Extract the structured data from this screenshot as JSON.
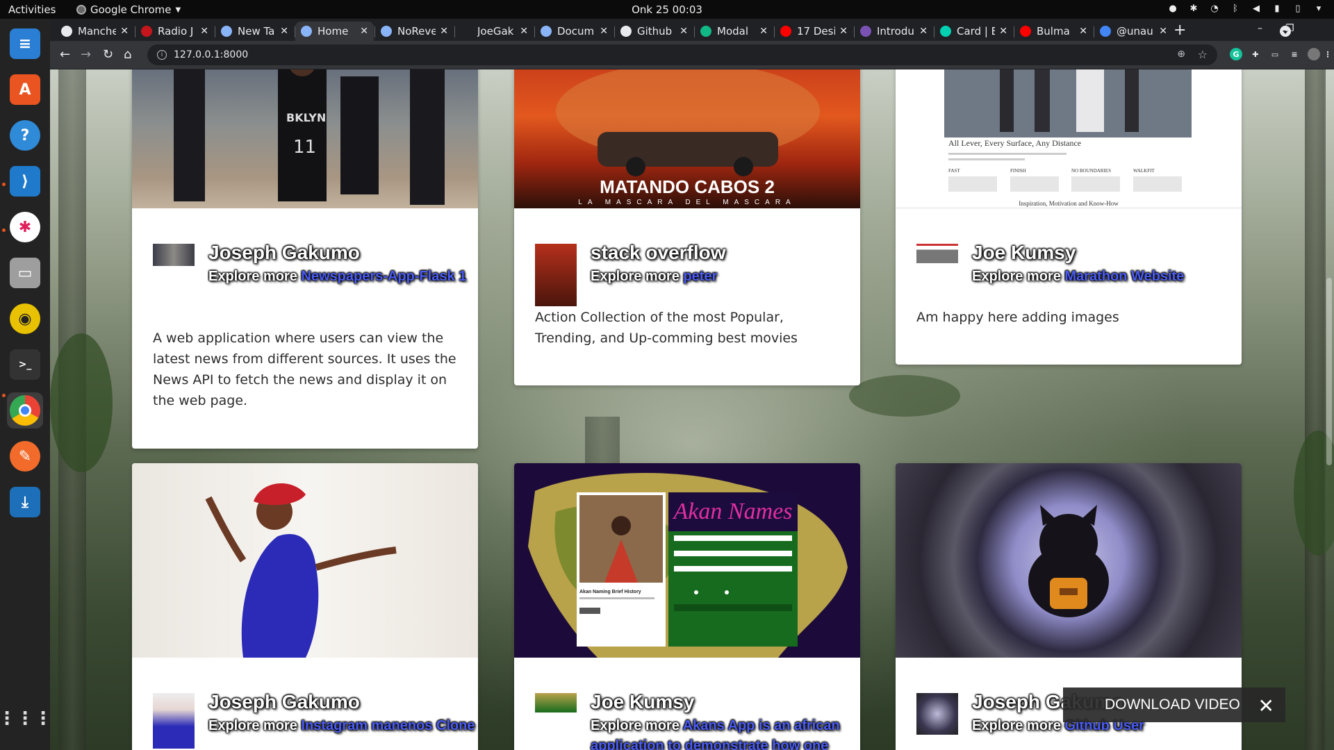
{
  "topbar": {
    "activities": "Activities",
    "app_name": "Google Chrome",
    "clock": "Onk 25  00:03"
  },
  "browser": {
    "tabs": [
      {
        "label": "Manche",
        "fav_color": "#e8eaed"
      },
      {
        "label": "Radio J",
        "fav_color": "#c4161c"
      },
      {
        "label": "New Ta",
        "fav_color": "#8ab4f8"
      },
      {
        "label": "Home",
        "fav_color": "#8ab4f8"
      },
      {
        "label": "NoReve",
        "fav_color": "#8ab4f8"
      },
      {
        "label": "JoeGak",
        "fav_color": "#202124"
      },
      {
        "label": "Docum",
        "fav_color": "#8ab4f8"
      },
      {
        "label": "Github",
        "fav_color": "#e8eaed"
      },
      {
        "label": "Modal",
        "fav_color": "#12b886"
      },
      {
        "label": "17 Desi",
        "fav_color": "#ff0000"
      },
      {
        "label": "Introdu",
        "fav_color": "#7952b3"
      },
      {
        "label": "Card | B",
        "fav_color": "#00d1b2"
      },
      {
        "label": "Bulma",
        "fav_color": "#ff0000"
      },
      {
        "label": "@unau",
        "fav_color": "#4285f4"
      }
    ],
    "url": "127.0.0.1:8000"
  },
  "cards": [
    {
      "author": "Joseph Gakumo",
      "explore_prefix": "Explore more",
      "project": "Newspapers-App-Flask 1",
      "description": "A web application where users can view the latest news from different sources. It uses the News API to fetch the news and display it on the web page."
    },
    {
      "author": "stack overflow",
      "explore_prefix": "Explore more",
      "project": "peter",
      "description": "Action Collection of the most Popular, Trending, and Up-comming best movies",
      "poster_title": "MATANDO CABOS 2",
      "poster_sub": "LA MASCARA DEL MASCARA"
    },
    {
      "author": "Joe Kumsy",
      "explore_prefix": "Explore more",
      "project": "Marathon Website",
      "description": "Am happy here adding images",
      "site_heading": "All Lever, Every Surface, Any Distance",
      "site_cols": [
        "FAST",
        "FINISH",
        "NO BOUNDARIES",
        "WALKFIT"
      ],
      "site_footer": "Inspiration, Motivation and Know-How"
    },
    {
      "author": "Joseph Gakumo",
      "explore_prefix": "Explore more",
      "project": "Instagram manenos Clone"
    },
    {
      "author": "Joe Kumsy",
      "explore_prefix": "Explore more",
      "project": "Akans App is an african application to demonstrate how one",
      "app_title": "Akan Names",
      "app_card_title": "Akan Naming Brief History"
    },
    {
      "author": "Joseph Gakumo",
      "explore_prefix": "Explore more",
      "project": "Github User"
    }
  ],
  "download_popup": {
    "label": "DOWNLOAD VIDEO"
  }
}
